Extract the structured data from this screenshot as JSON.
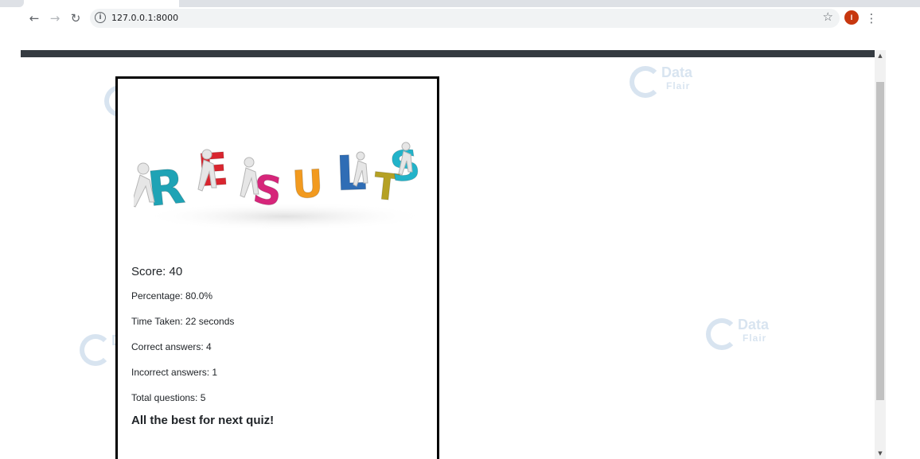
{
  "browser": {
    "back_icon": "arrow-left",
    "forward_icon": "arrow-right",
    "reload_icon": "reload",
    "url": "127.0.0.1:8000",
    "avatar_letter": "I"
  },
  "watermark": {
    "data": "Data",
    "flair": "Flair"
  },
  "results": {
    "banner_letters": [
      "R",
      "E",
      "S",
      "U",
      "L",
      "T",
      "S"
    ],
    "banner_colors": [
      "#1fa3b5",
      "#d9252f",
      "#d6257a",
      "#f29a1f",
      "#2f6db5",
      "#b5a124",
      "#22b3c9"
    ],
    "score": "Score: 40",
    "percentage": "Percentage: 80.0%",
    "time_taken": "Time Taken: 22 seconds",
    "correct": "Correct answers: 4",
    "incorrect": "Incorrect answers: 1",
    "total": "Total questions: 5",
    "closing": "All the best for next quiz!"
  }
}
